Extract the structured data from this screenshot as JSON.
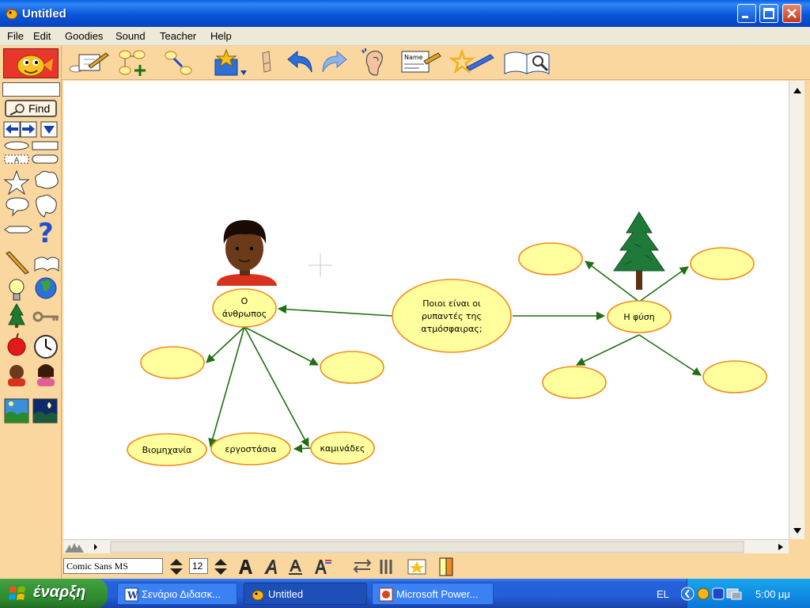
{
  "window": {
    "title": "Untitled"
  },
  "menu": [
    "File",
    "Edit",
    "Goodies",
    "Sound",
    "Teacher",
    "Help"
  ],
  "palette": {
    "find_label": "Find",
    "find_value": "",
    "text_tool_label": "A"
  },
  "toolbar": {
    "name_label": "Name"
  },
  "colors": {
    "node_fill": "#ffff9e",
    "node_stroke": "#f28b1e",
    "link": "#1f6e12",
    "accent": "#fbd7a0"
  },
  "concept_map": {
    "center": {
      "lines": [
        "Ποιοι είναι οι",
        "ρυπαντές της",
        "ατμόσφαιρας;"
      ]
    },
    "human": {
      "lines": [
        "Ο",
        "άνθρωπος"
      ]
    },
    "nature": {
      "label": "Η φύση"
    },
    "industry": {
      "label": "Βιομηχανία"
    },
    "factories": {
      "label": "εργοστάσια"
    },
    "chimneys": {
      "label": "καμινάδες"
    }
  },
  "fontbar": {
    "font_name": "Comic Sans MS",
    "font_size": "12"
  },
  "taskbar": {
    "start_label": "έναρξη",
    "tasks": [
      {
        "label": "Σενάριο Διδασκ...",
        "icon": "word-icon"
      },
      {
        "label": "Untitled",
        "icon": "kidspiration-icon"
      },
      {
        "label": "Microsoft Power...",
        "icon": "powerpoint-icon"
      }
    ],
    "language": "EL",
    "clock": "5:00 μμ"
  }
}
